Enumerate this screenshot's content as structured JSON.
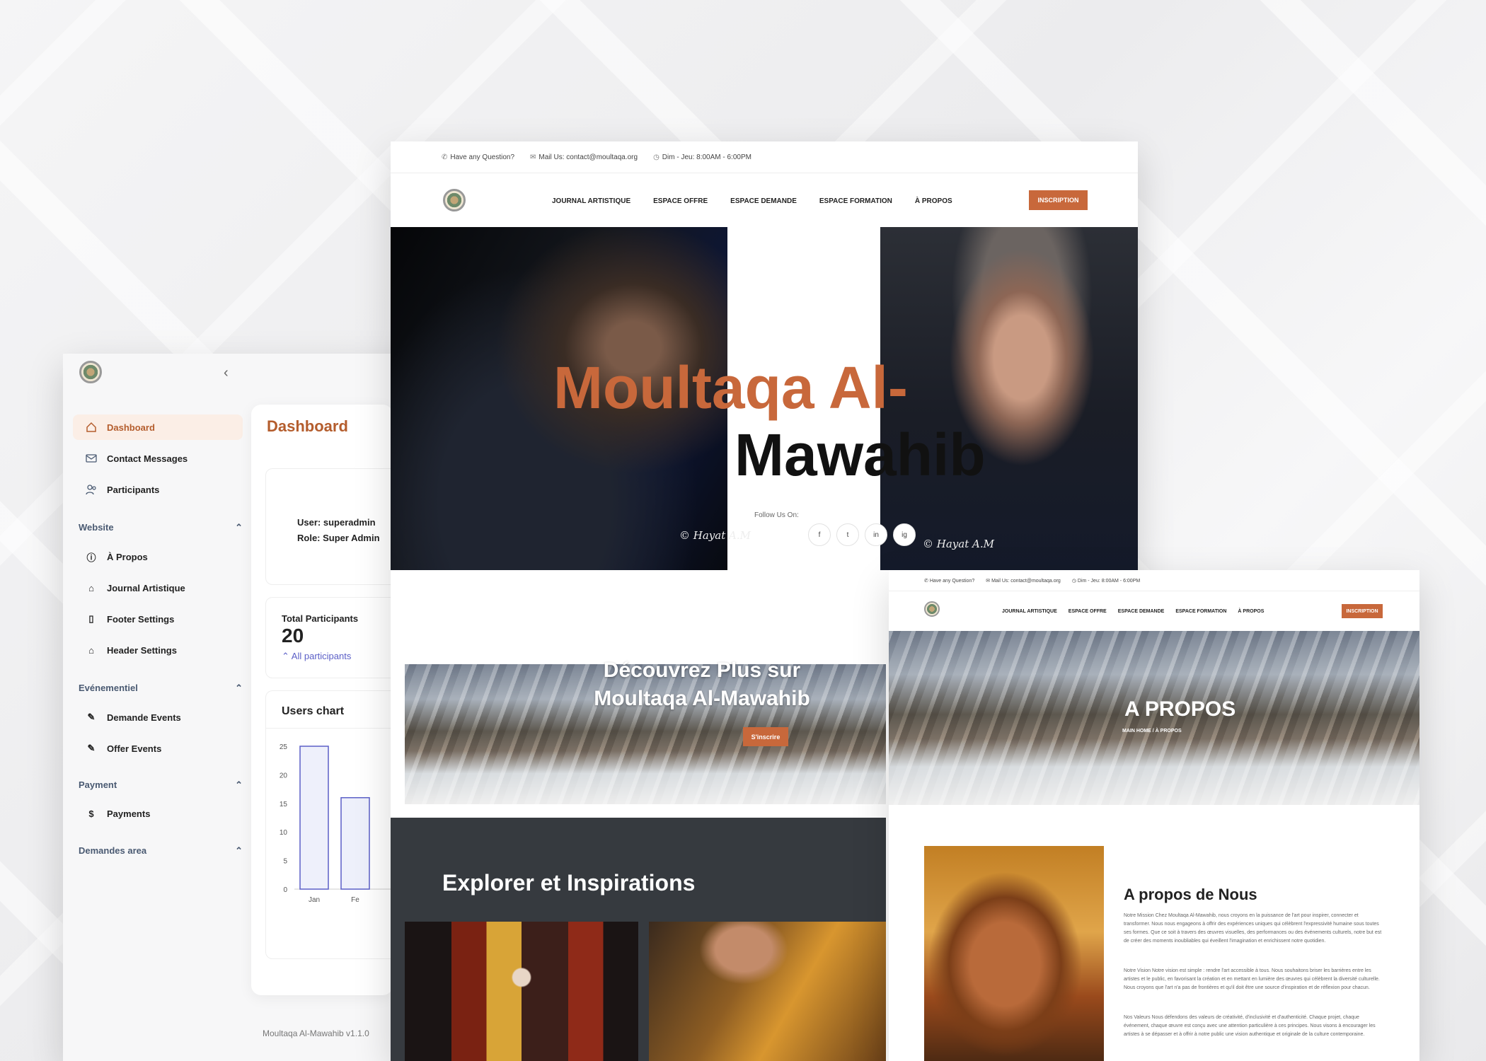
{
  "admin": {
    "nav": [
      {
        "label": "Dashboard",
        "icon": "home-icon"
      },
      {
        "label": "Contact Messages",
        "icon": "mail-icon"
      },
      {
        "label": "Participants",
        "icon": "users-icon"
      }
    ],
    "sections": [
      {
        "title": "Website",
        "items": [
          "À Propos",
          "Journal Artistique",
          "Footer Settings",
          "Header Settings"
        ]
      },
      {
        "title": "Evénementiel",
        "items": [
          "Demande Events",
          "Offer Events"
        ]
      },
      {
        "title": "Payment",
        "items": [
          "Payments"
        ]
      },
      {
        "title": "Demandes area",
        "items": []
      }
    ],
    "dashboard": {
      "title": "Dashboard",
      "user": "User: superadmin",
      "role": "Role: Super Admin",
      "total_label": "Total Participants",
      "total_value": "20",
      "all_link": "All participants",
      "chart_title": "Users chart"
    },
    "version": "Moultaqa Al-Mawahib v1.1.0"
  },
  "chart_data": {
    "type": "bar",
    "title": "Users chart",
    "categories": [
      "Jan",
      "Fe"
    ],
    "values": [
      25,
      16
    ],
    "ylim": [
      0,
      25
    ],
    "yticks": [
      "25",
      "20",
      "15",
      "10",
      "5",
      "0"
    ],
    "color": "#5b5fc7"
  },
  "site": {
    "topbar": {
      "question": "Have any Question?",
      "mail": "Mail Us: contact@moultaqa.org",
      "hours": "Dim - Jeu: 8:00AM - 6:00PM"
    },
    "nav": [
      "JOURNAL ARTISTIQUE",
      "ESPACE OFFRE",
      "ESPACE DEMANDE",
      "ESPACE FORMATION",
      "À PROPOS"
    ],
    "cta": "INSCRIPTION",
    "hero_line1": "Moultaqa Al-",
    "hero_line2": "Mawahib",
    "follow": "Follow Us On:",
    "social": [
      "f",
      "t",
      "in",
      "ig"
    ],
    "signature": "© Hayat A.M",
    "banner_title": "Découvrez Plus sur Moultaqa Al-Mawahib",
    "banner_btn": "S'inscrire",
    "explore": "Explorer et Inspirations",
    "accent": "#c8683b"
  },
  "site2": {
    "about_title": "A PROPOS",
    "crumb": "MAIN HOME / À PROPOS",
    "about_heading": "A propos de Nous",
    "p1": "Notre Mission Chez Moultaqa Al-Mawahib, nous croyons en la puissance de l'art pour inspirer, connecter et transformer. Nous nous engageons à offrir des expériences uniques qui célèbrent l'expressivité humaine sous toutes ses formes. Que ce soit à travers des œuvres visuelles, des performances ou des événements culturels, notre but est de créer des moments inoubliables qui éveillent l'imagination et enrichissent notre quotidien.",
    "p2": "Notre Vision Notre vision est simple : rendre l'art accessible à tous. Nous souhaitons briser les barrières entre les artistes et le public, en favorisant la création et en mettant en lumière des œuvres qui célèbrent la diversité culturelle. Nous croyons que l'art n'a pas de frontières et qu'il doit être une source d'inspiration et de réflexion pour chacun.",
    "p3": "Nos Valeurs Nous défendons des valeurs de créativité, d'inclusivité et d'authenticité. Chaque projet, chaque événement, chaque œuvre est conçu avec une attention particulière à ces principes. Nous visons à encourager les artistes à se dépasser et à offrir à notre public une vision authentique et originale de la culture contemporaine."
  }
}
